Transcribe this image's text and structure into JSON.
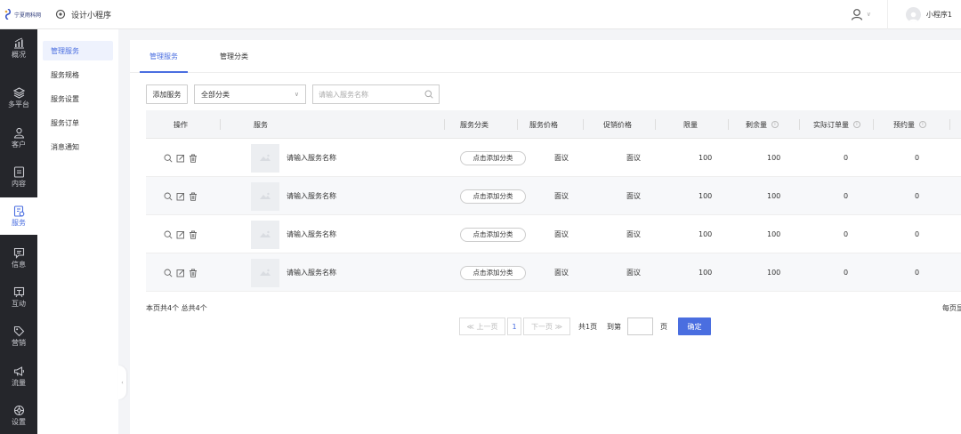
{
  "brand": {
    "name": "宁夏雨科网"
  },
  "header": {
    "app_tab_label": "设计小程序",
    "account_name": "小程序1"
  },
  "leftnav": [
    {
      "label": "概况",
      "icon": "chart-icon",
      "active": false
    },
    {
      "label": "多平台",
      "icon": "layers-icon",
      "active": false
    },
    {
      "label": "客户",
      "icon": "user-icon",
      "active": false
    },
    {
      "label": "内容",
      "icon": "document-icon",
      "active": false
    },
    {
      "label": "服务",
      "icon": "service-icon",
      "active": true
    },
    {
      "label": "信息",
      "icon": "message-icon",
      "active": false
    },
    {
      "label": "互动",
      "icon": "interact-icon",
      "active": false
    },
    {
      "label": "营销",
      "icon": "tag-icon",
      "active": false
    },
    {
      "label": "流量",
      "icon": "megaphone-icon",
      "active": false
    },
    {
      "label": "设置",
      "icon": "gear-icon",
      "active": false
    }
  ],
  "subnav": [
    {
      "label": "管理服务",
      "active": true
    },
    {
      "label": "服务规格",
      "active": false
    },
    {
      "label": "服务设置",
      "active": false
    },
    {
      "label": "服务订单",
      "active": false
    },
    {
      "label": "消息通知",
      "active": false
    }
  ],
  "tabs": [
    {
      "label": "管理服务",
      "active": true
    },
    {
      "label": "管理分类",
      "active": false
    }
  ],
  "toolbar": {
    "add_label": "添加服务",
    "category_selected": "全部分类",
    "search_placeholder": "请输入服务名称"
  },
  "table": {
    "headers": {
      "ops": "操作",
      "service": "服务",
      "category": "服务分类",
      "price": "服务价格",
      "promo": "促销价格",
      "limit": "限量",
      "remaining": "剩余量",
      "orders": "实际订单量",
      "reserved": "预约量"
    },
    "rows": [
      {
        "name": "请输入服务名称",
        "category": "点击添加分类",
        "price": "面议",
        "promo": "面议",
        "limit": "100",
        "remaining": "100",
        "orders": "0",
        "reserved": "0"
      },
      {
        "name": "请输入服务名称",
        "category": "点击添加分类",
        "price": "面议",
        "promo": "面议",
        "limit": "100",
        "remaining": "100",
        "orders": "0",
        "reserved": "0"
      },
      {
        "name": "请输入服务名称",
        "category": "点击添加分类",
        "price": "面议",
        "promo": "面议",
        "limit": "100",
        "remaining": "100",
        "orders": "0",
        "reserved": "0"
      },
      {
        "name": "请输入服务名称",
        "category": "点击添加分类",
        "price": "面议",
        "promo": "面议",
        "limit": "100",
        "remaining": "100",
        "orders": "0",
        "reserved": "0"
      }
    ]
  },
  "footer": {
    "summary": "本页共4个  总共4个",
    "per_page": "每页显",
    "prev": "≪ 上一页",
    "current_page": "1",
    "next": "下一页 ≫",
    "total_pages": "共1页",
    "goto_label": "到第",
    "page_unit": "页",
    "confirm": "确定"
  },
  "colors": {
    "accent": "#4a6ee0",
    "sidebar_bg": "#25262b"
  }
}
